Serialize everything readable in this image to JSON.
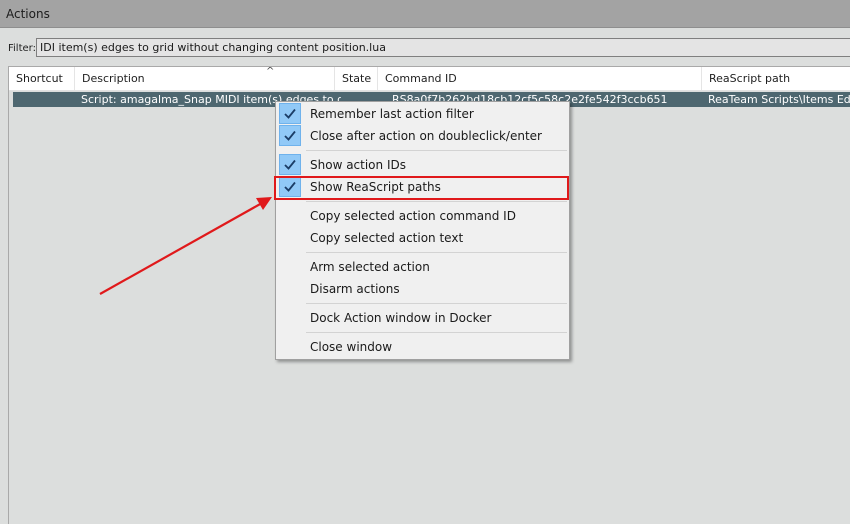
{
  "window": {
    "title": "Actions"
  },
  "filter": {
    "label": "Filter:",
    "value": "IDI item(s) edges to grid without changing content position.lua"
  },
  "table": {
    "columns": [
      "Shortcut",
      "Description",
      "State",
      "Command ID",
      "ReaScript path"
    ],
    "sort_indicator": "^",
    "rows": [
      {
        "shortcut": "",
        "description": "Script: amagalma_Snap MIDI item(s) edges to grid",
        "state": "",
        "command_id": "RS8a0f7b262bd18cb12cf5c58c2e2fe542f3ccb651",
        "reascript_path": "ReaTeam Scripts\\Items Editing"
      }
    ]
  },
  "context_menu": {
    "items": [
      {
        "label": "Remember last action filter",
        "checked": true
      },
      {
        "label": "Close after action on doubleclick/enter",
        "checked": true
      },
      {
        "label": "Show action IDs",
        "checked": true
      },
      {
        "label": "Show ReaScript paths",
        "checked": true
      },
      {
        "label": "Copy selected action command ID",
        "checked": false
      },
      {
        "label": "Copy selected action text",
        "checked": false
      },
      {
        "label": "Arm selected action",
        "checked": false
      },
      {
        "label": "Disarm actions",
        "checked": false
      },
      {
        "label": "Dock Action window in Docker",
        "checked": false
      },
      {
        "label": "Close window",
        "checked": false
      }
    ]
  },
  "colors": {
    "annotation": "#e0191b",
    "selected_row": "#4e6770",
    "check_bg": "#91c9f7"
  }
}
